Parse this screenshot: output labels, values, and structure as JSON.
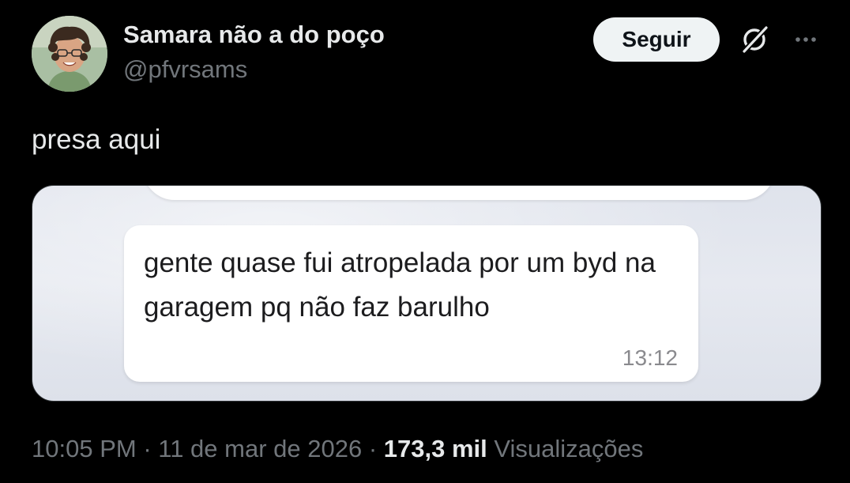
{
  "author": {
    "display_name": "Samara não a do poço",
    "handle": "@pfvrsams"
  },
  "actions": {
    "follow_label": "Seguir",
    "grok_icon": "grok-icon",
    "more_icon": "more-icon"
  },
  "tweet": {
    "text": "presa aqui"
  },
  "media": {
    "message_text": "gente quase fui atropelada por um byd na garagem pq não faz barulho",
    "message_time": "13:12"
  },
  "meta": {
    "time": "10:05 PM",
    "separator1": " · ",
    "date": "11 de mar de 2026",
    "separator2": " · ",
    "views_count": "173,3 mil",
    "views_label": "Visualizações"
  },
  "colors": {
    "background": "#000000",
    "text_primary": "#e7e9ea",
    "text_secondary": "#71767b",
    "follow_bg": "#eff3f4"
  }
}
